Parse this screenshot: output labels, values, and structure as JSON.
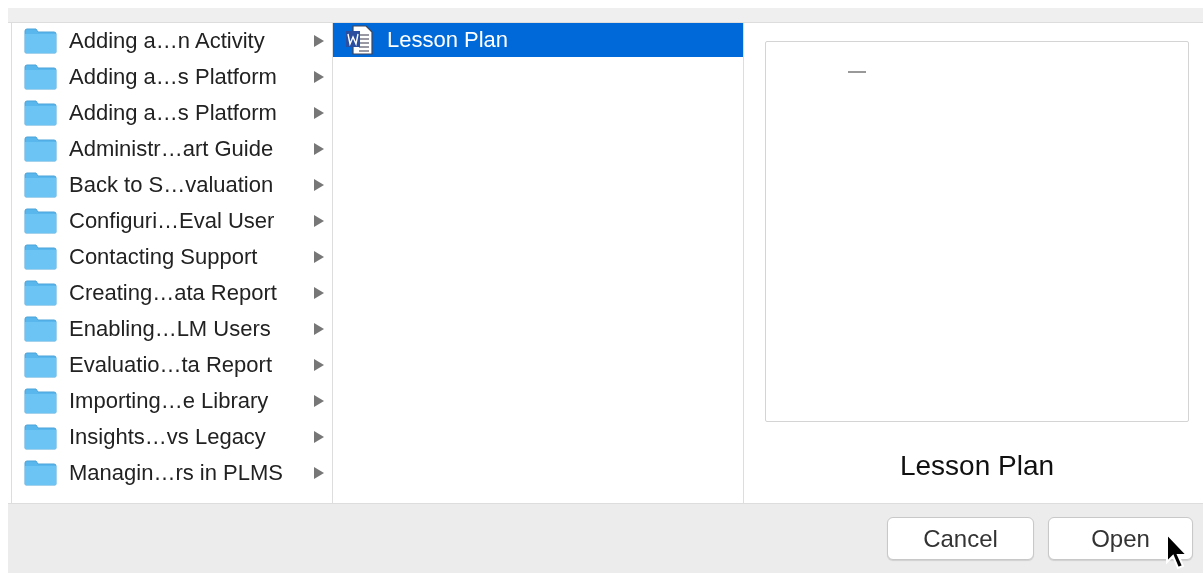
{
  "folders": [
    {
      "name": "Adding a…n Activity",
      "selected": false
    },
    {
      "name": "Adding a…s Platform",
      "selected": false
    },
    {
      "name": "Adding a…s Platform",
      "selected": false
    },
    {
      "name": "Administr…art Guide",
      "selected": false
    },
    {
      "name": "Back to S…valuation",
      "selected": false
    },
    {
      "name": "Configuri…Eval User",
      "selected": false
    },
    {
      "name": "Contacting Support",
      "selected": false
    },
    {
      "name": "Creating…ata Report",
      "selected": false
    },
    {
      "name": "Enabling…LM Users",
      "selected": false
    },
    {
      "name": "Evaluatio…ta Report",
      "selected": false
    },
    {
      "name": "Importing…e Library",
      "selected": false
    },
    {
      "name": "Insights…vs Legacy",
      "selected": false
    },
    {
      "name": "Managin…rs in PLMS",
      "selected": false
    }
  ],
  "files": [
    {
      "name": "Lesson Plan",
      "selected": true
    }
  ],
  "preview": {
    "title": "Lesson Plan"
  },
  "buttons": [
    {
      "label": "Cancel",
      "kind": "cancel"
    },
    {
      "label": "Open",
      "kind": "default"
    }
  ]
}
